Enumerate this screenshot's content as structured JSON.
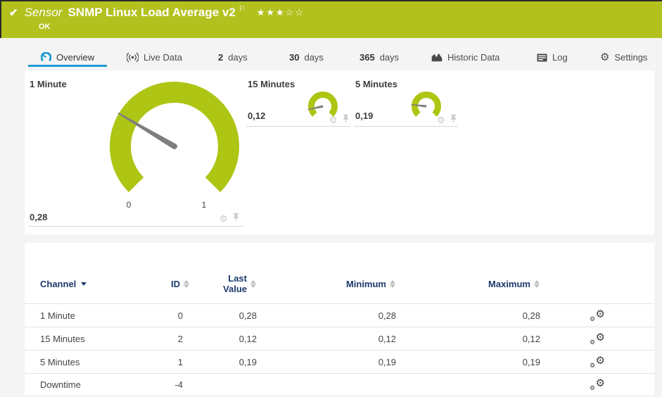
{
  "colors": {
    "ok_green": "#b3c11e",
    "gauge_green": "#aec514",
    "accent_blue": "#1d9ad2",
    "table_header_navy": "#1b3a6b"
  },
  "header": {
    "check_icon": "✔",
    "type_label": "Sensor",
    "title": "SNMP Linux Load Average v2",
    "flag_icon": "⚐",
    "stars": "★★★☆☆",
    "status": "OK"
  },
  "tabs": [
    {
      "label": "Overview",
      "active": true
    },
    {
      "label": "Live Data"
    },
    {
      "num": "2",
      "label": "days"
    },
    {
      "num": "30",
      "label": "days"
    },
    {
      "num": "365",
      "label": "days"
    },
    {
      "label": "Historic Data"
    },
    {
      "label": "Log"
    },
    {
      "label": "Settings"
    }
  ],
  "icons": {
    "gear": "⚙"
  },
  "gauges": [
    {
      "title": "1 Minute",
      "value": 0.28,
      "value_label": "0,28",
      "scale_min": "0",
      "scale_max": "1"
    },
    {
      "title": "15 Minutes",
      "value": 0.12,
      "value_label": "0,12"
    },
    {
      "title": "5 Minutes",
      "value": 0.19,
      "value_label": "0,19"
    }
  ],
  "table": {
    "columns": {
      "channel": "Channel",
      "id": "ID",
      "last_value": "Last Value",
      "minimum": "Minimum",
      "maximum": "Maximum"
    },
    "rows": [
      {
        "channel": "1 Minute",
        "id": "0",
        "last_value": "0,28",
        "minimum": "0,28",
        "maximum": "0,28"
      },
      {
        "channel": "15 Minutes",
        "id": "2",
        "last_value": "0,12",
        "minimum": "0,12",
        "maximum": "0,12"
      },
      {
        "channel": "5 Minutes",
        "id": "1",
        "last_value": "0,19",
        "minimum": "0,19",
        "maximum": "0,19"
      },
      {
        "channel": "Downtime",
        "id": "-4",
        "last_value": "",
        "minimum": "",
        "maximum": ""
      }
    ]
  }
}
